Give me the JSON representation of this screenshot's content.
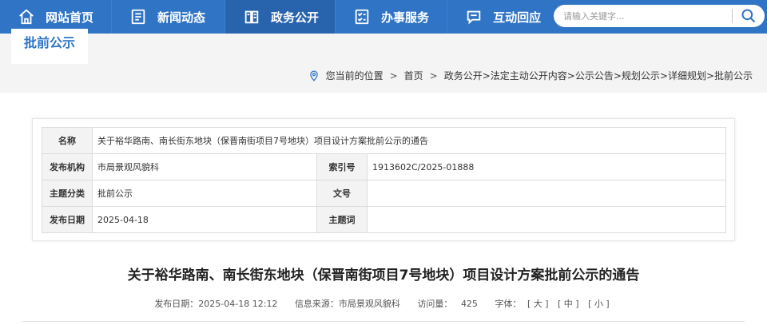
{
  "nav": {
    "items": [
      {
        "label": "网站首页",
        "icon": "home-icon"
      },
      {
        "label": "新闻动态",
        "icon": "news-icon"
      },
      {
        "label": "政务公开",
        "icon": "gov-affairs-icon"
      },
      {
        "label": "办事服务",
        "icon": "service-icon"
      },
      {
        "label": "互动回应",
        "icon": "chat-icon"
      }
    ],
    "active_index": 2,
    "bg_color": "#2f74c5"
  },
  "search": {
    "placeholder": "请输入关键字..."
  },
  "header": {
    "section_title": "批前公示"
  },
  "breadcrumb": {
    "prefix": "您当前的位置",
    "home": "首页",
    "path": "政务公开>法定主动公开内容>公示公告>规划公示>详细规划>批前公示"
  },
  "info": {
    "name_label": "名称",
    "name_value": "关于裕华路南、南长街东地块（保晋南街项目7号地块）项目设计方案批前公示的通告",
    "org_label": "发布机构",
    "org_value": "市局景观风貌科",
    "index_label": "索引号",
    "index_value": "1913602C/2025-01888",
    "category_label": "主题分类",
    "category_value": "批前公示",
    "docno_label": "文号",
    "docno_value": "",
    "date_label": "发布日期",
    "date_value": "2025-04-18",
    "keyword_label": "主题词",
    "keyword_value": ""
  },
  "article": {
    "title": "关于裕华路南、南长街东地块（保晋南街项目7号地块）项目设计方案批前公示的通告",
    "publish_date": "发布日期：2025-04-18 12:12",
    "source": "信息来源：市局景观风貌科",
    "views_label": "访问量：",
    "views_value": "425",
    "font_label": "字体：",
    "font_large": "[ 大 ]",
    "font_medium": "[ 中 ]",
    "font_small": "[ 小 ]"
  }
}
